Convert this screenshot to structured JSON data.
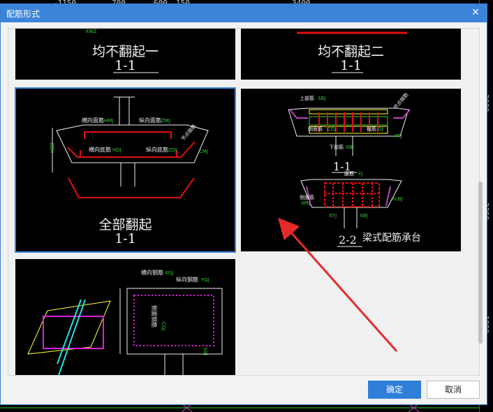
{
  "background": {
    "axis_texts": [
      "-1150",
      "700",
      "600",
      "150",
      "3400"
    ]
  },
  "dialog": {
    "title": "配筋形式",
    "close_glyph": "✕",
    "ok_label": "确定",
    "cancel_label": "取消"
  },
  "options": [
    {
      "caption": "均不翻起一",
      "section": "1-1"
    },
    {
      "caption": "均不翻起二",
      "section": "1-1"
    },
    {
      "caption": "全部翻起",
      "section": "1-1",
      "labels": {
        "hxmj": "横向面筋",
        "hxmj_code": "HMJ",
        "zxmj": "纵向面筋",
        "zxmj_code": "ZMJ",
        "hxdj": "横向底筋",
        "hxdj_code": "HDJ",
        "zxdj": "纵向底筋",
        "zxdj_code": "ZDJ",
        "side": "HZZ",
        "cmj": "CMJ",
        "right_note": "节点钢筋"
      }
    },
    {
      "caption": "梁式配筋承台",
      "section_a": "1-1",
      "section_b": "2-2",
      "labels": {
        "top": "上部筋",
        "top_code": "SBJ",
        "sj": "侧面筋",
        "sj_code": "CGJ",
        "gj": "箍筋",
        "gj_code": "GJ",
        "bottom": "下部筋",
        "bottom_code": "XBJ",
        "side_code": "PPJ",
        "right_note": "节点钢筋",
        "yj": "腰筋",
        "yj_code": "YJ",
        "cmj2": "侧面筋",
        "cmj2_code": "XMJ",
        "xyj": "XYJ",
        "xlbj": "XLBJ",
        "xbj2": "XBJ"
      }
    },
    {
      "labels": {
        "hxgj": "横向钢筋",
        "hxgj_code": "XGJ",
        "zxgj": "纵向钢筋",
        "zxgj_code": "YGJ",
        "cmgj": "侧面钢筋",
        "cmgj_code": "CGJ",
        "sgj": "SGJ"
      }
    }
  ],
  "right_strip_numbers": [
    "3000",
    "2300",
    "1900"
  ]
}
